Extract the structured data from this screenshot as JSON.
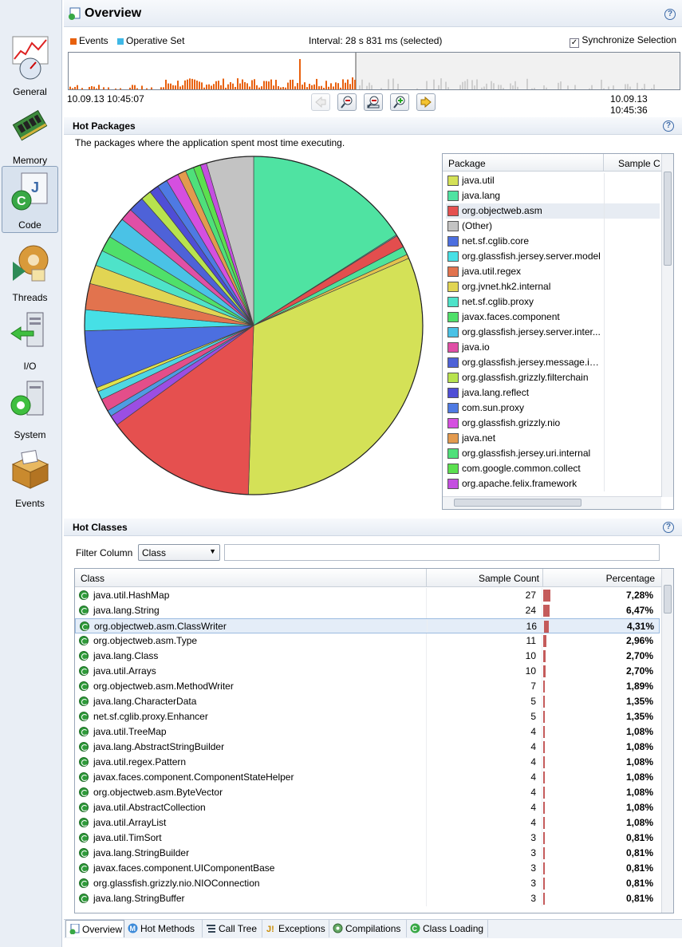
{
  "sidebar": {
    "items": [
      {
        "label": "General",
        "icon": "gauge-chart-icon"
      },
      {
        "label": "Memory",
        "icon": "memory-chip-icon"
      },
      {
        "label": "Code",
        "icon": "code-java-icon",
        "active": true
      },
      {
        "label": "Threads",
        "icon": "threads-gear-icon"
      },
      {
        "label": "I/O",
        "icon": "io-arrows-icon"
      },
      {
        "label": "System",
        "icon": "system-computer-icon"
      },
      {
        "label": "Events",
        "icon": "events-box-icon"
      }
    ]
  },
  "overview": {
    "title": "Overview",
    "legend_events": "Events",
    "legend_operative": "Operative Set",
    "interval": "Interval: 28 s 831 ms (selected)",
    "sync_label": "Synchronize Selection",
    "start_time": "10.09.13 10:45:07",
    "end_time": "10.09.13 10:45:36"
  },
  "colors": {
    "events": "#e8610e",
    "operative": "#3fb8e6",
    "header_bg": "#e6ecf4"
  },
  "hot_packages": {
    "title": "Hot Packages",
    "description": "The packages where the application spent most time executing.",
    "col_package": "Package",
    "col_sample": "Sample C",
    "rows": [
      {
        "name": "java.util",
        "color": "#d4e157"
      },
      {
        "name": "java.lang",
        "color": "#4fe3a2"
      },
      {
        "name": "org.objectweb.asm",
        "color": "#e5504f"
      },
      {
        "name": "(Other)",
        "color": "#c3c3c3"
      },
      {
        "name": "net.sf.cglib.core",
        "color": "#4c6fe0"
      },
      {
        "name": "org.glassfish.jersey.server.model",
        "color": "#46e0e6"
      },
      {
        "name": "java.util.regex",
        "color": "#e2734e"
      },
      {
        "name": "org.jvnet.hk2.internal",
        "color": "#e1d553"
      },
      {
        "name": "net.sf.cglib.proxy",
        "color": "#4ee3c9"
      },
      {
        "name": "javax.faces.component",
        "color": "#4fe06a"
      },
      {
        "name": "org.glassfish.jersey.server.inter...",
        "color": "#4ac2e6"
      },
      {
        "name": "java.io",
        "color": "#e04fa6"
      },
      {
        "name": "org.glassfish.jersey.message.int...",
        "color": "#4e62d8"
      },
      {
        "name": "org.glassfish.grizzly.filterchain",
        "color": "#b8e34e"
      },
      {
        "name": "java.lang.reflect",
        "color": "#4f4ed6"
      },
      {
        "name": "com.sun.proxy",
        "color": "#4e7ae3"
      },
      {
        "name": "org.glassfish.grizzly.nio",
        "color": "#d54fe0"
      },
      {
        "name": "java.net",
        "color": "#e39a4e"
      },
      {
        "name": "org.glassfish.jersey.uri.internal",
        "color": "#4fe07a"
      },
      {
        "name": "com.google.common.collect",
        "color": "#5be04f"
      },
      {
        "name": "org.apache.felix.framework",
        "color": "#c44fe0"
      }
    ]
  },
  "hot_classes": {
    "title": "Hot Classes",
    "filter_label": "Filter Column",
    "filter_value": "Class",
    "col_class": "Class",
    "col_count": "Sample Count",
    "col_pct": "Percentage",
    "rows": [
      {
        "name": "java.util.HashMap",
        "count": "27",
        "pct": "7,28%",
        "v": 7.28
      },
      {
        "name": "java.lang.String",
        "count": "24",
        "pct": "6,47%",
        "v": 6.47
      },
      {
        "name": "org.objectweb.asm.ClassWriter",
        "count": "16",
        "pct": "4,31%",
        "v": 4.31
      },
      {
        "name": "org.objectweb.asm.Type",
        "count": "11",
        "pct": "2,96%",
        "v": 2.96
      },
      {
        "name": "java.lang.Class",
        "count": "10",
        "pct": "2,70%",
        "v": 2.7
      },
      {
        "name": "java.util.Arrays",
        "count": "10",
        "pct": "2,70%",
        "v": 2.7
      },
      {
        "name": "org.objectweb.asm.MethodWriter",
        "count": "7",
        "pct": "1,89%",
        "v": 1.89
      },
      {
        "name": "java.lang.CharacterData",
        "count": "5",
        "pct": "1,35%",
        "v": 1.35
      },
      {
        "name": "net.sf.cglib.proxy.Enhancer",
        "count": "5",
        "pct": "1,35%",
        "v": 1.35
      },
      {
        "name": "java.util.TreeMap",
        "count": "4",
        "pct": "1,08%",
        "v": 1.08
      },
      {
        "name": "java.lang.AbstractStringBuilder",
        "count": "4",
        "pct": "1,08%",
        "v": 1.08
      },
      {
        "name": "java.util.regex.Pattern",
        "count": "4",
        "pct": "1,08%",
        "v": 1.08
      },
      {
        "name": "javax.faces.component.ComponentStateHelper",
        "count": "4",
        "pct": "1,08%",
        "v": 1.08
      },
      {
        "name": "org.objectweb.asm.ByteVector",
        "count": "4",
        "pct": "1,08%",
        "v": 1.08
      },
      {
        "name": "java.util.AbstractCollection",
        "count": "4",
        "pct": "1,08%",
        "v": 1.08
      },
      {
        "name": "java.util.ArrayList",
        "count": "4",
        "pct": "1,08%",
        "v": 1.08
      },
      {
        "name": "java.util.TimSort",
        "count": "3",
        "pct": "0,81%",
        "v": 0.81
      },
      {
        "name": "java.lang.StringBuilder",
        "count": "3",
        "pct": "0,81%",
        "v": 0.81
      },
      {
        "name": "javax.faces.component.UIComponentBase",
        "count": "3",
        "pct": "0,81%",
        "v": 0.81
      },
      {
        "name": "org.glassfish.grizzly.nio.NIOConnection",
        "count": "3",
        "pct": "0,81%",
        "v": 0.81
      },
      {
        "name": "java.lang.StringBuffer",
        "count": "3",
        "pct": "0,81%",
        "v": 0.81
      }
    ]
  },
  "tabs": [
    {
      "label": "Overview",
      "icon": "overview-icon",
      "active": true
    },
    {
      "label": "Hot Methods",
      "icon": "method-icon"
    },
    {
      "label": "Call Tree",
      "icon": "tree-icon"
    },
    {
      "label": "Exceptions",
      "icon": "exception-icon"
    },
    {
      "label": "Compilations",
      "icon": "compilation-icon"
    },
    {
      "label": "Class Loading",
      "icon": "class-loading-icon"
    }
  ]
}
